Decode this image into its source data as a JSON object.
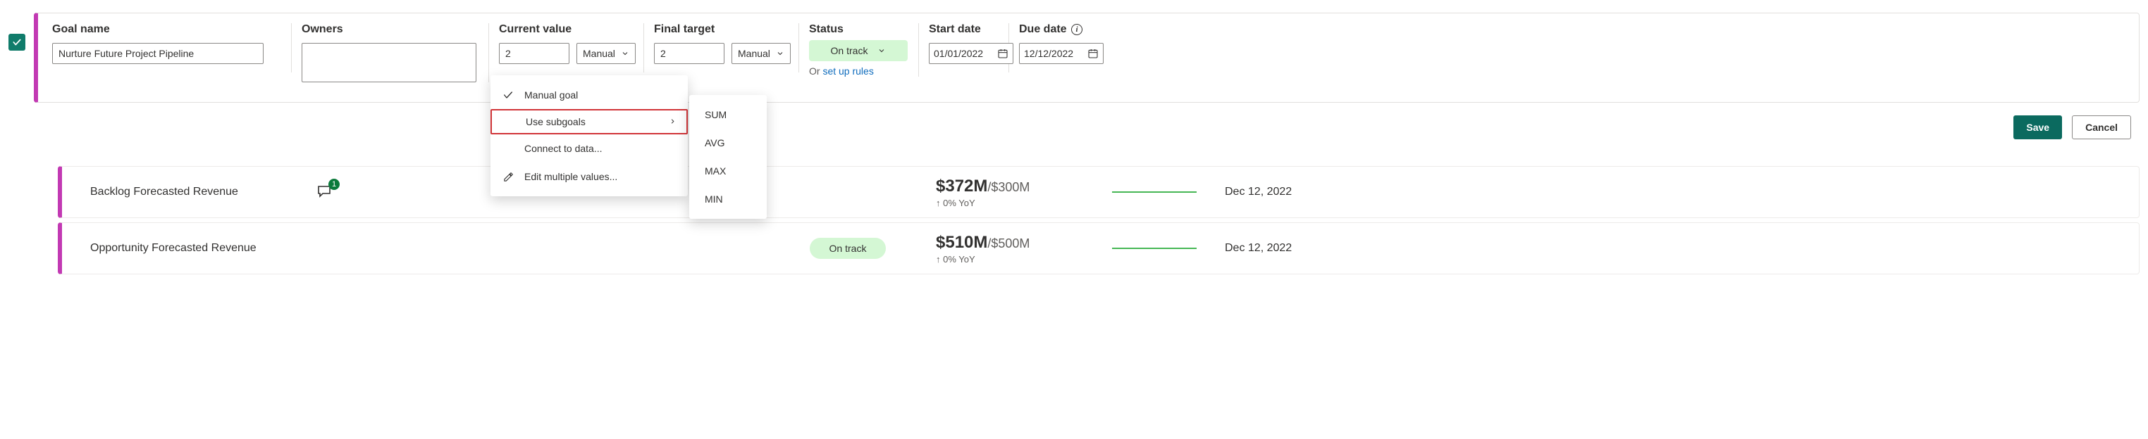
{
  "editor": {
    "goal_name": {
      "label": "Goal name",
      "value": "Nurture Future Project Pipeline"
    },
    "owners": {
      "label": "Owners"
    },
    "current_value": {
      "label": "Current value",
      "value": "2",
      "mode": "Manual"
    },
    "final_target": {
      "label": "Final target",
      "value": "2",
      "mode": "Manual"
    },
    "status": {
      "label": "Status",
      "value": "On track",
      "or_text": "Or ",
      "rules_link": "set up rules"
    },
    "start_date": {
      "label": "Start date",
      "value": "01/01/2022"
    },
    "due_date": {
      "label": "Due date",
      "value": "12/12/2022"
    }
  },
  "current_menu": {
    "manual": "Manual goal",
    "subgoals": "Use subgoals",
    "connect": "Connect to data...",
    "edit_multi": "Edit multiple values..."
  },
  "agg_menu": {
    "sum": "SUM",
    "avg": "AVG",
    "max": "MAX",
    "min": "MIN"
  },
  "actions": {
    "save": "Save",
    "cancel": "Cancel"
  },
  "goals": [
    {
      "name": "Backlog Forecasted Revenue",
      "chat_count": "1",
      "value_main": "$372M",
      "value_target": "/$300M",
      "yoy": "↑ 0% YoY",
      "due": "Dec 12, 2022",
      "status": ""
    },
    {
      "name": "Opportunity Forecasted Revenue",
      "chat_count": "",
      "value_main": "$510M",
      "value_target": "/$500M",
      "yoy": "↑ 0% YoY",
      "due": "Dec 12, 2022",
      "status": "On track"
    }
  ]
}
